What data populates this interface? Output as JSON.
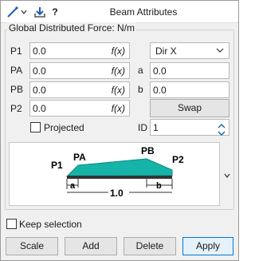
{
  "titlebar": {
    "title": "Beam Attributes",
    "help": "?",
    "icons": [
      "line-tool-icon",
      "dropdown-arrow-icon",
      "download-icon",
      "help-icon"
    ]
  },
  "group": {
    "title": "Global Distributed Force: N/m"
  },
  "fields": {
    "p1": {
      "label": "P1",
      "value": "0.0",
      "fx": "f(x)"
    },
    "pa": {
      "label": "PA",
      "value": "0.0",
      "fx": "f(x)"
    },
    "pb": {
      "label": "PB",
      "value": "0.0",
      "fx": "f(x)"
    },
    "p2": {
      "label": "P2",
      "value": "0.0",
      "fx": "f(x)"
    }
  },
  "direction": {
    "value": "Dir X"
  },
  "a": {
    "label": "a",
    "value": "0.0"
  },
  "b": {
    "label": "b",
    "value": "0.0"
  },
  "swap_label": "Swap",
  "projected": {
    "label": "Projected",
    "checked": false
  },
  "id": {
    "label": "ID",
    "value": "1"
  },
  "diagram": {
    "p1": "P1",
    "pa": "PA",
    "pb": "PB",
    "p2": "P2",
    "a": "a",
    "b": "b",
    "length": "1.0",
    "fill_color": "#16b3a8"
  },
  "keep_selection": {
    "label": "Keep selection",
    "checked": false
  },
  "buttons": {
    "scale": "Scale",
    "add": "Add",
    "delete": "Delete",
    "apply": "Apply"
  }
}
